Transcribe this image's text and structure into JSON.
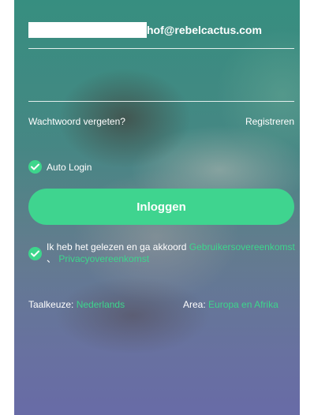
{
  "login": {
    "email_value": "hof@rebelcactus.com",
    "password_value": "",
    "forgot_label": "Wachtwoord vergeten?",
    "register_label": "Registreren",
    "auto_login_label": "Auto Login",
    "login_button": "Inloggen"
  },
  "agreement": {
    "text": "Ik heb het gelezen en ga akkoord ",
    "terms_link": "Gebruikersovereenkomst",
    "separator": " 、 ",
    "privacy_link": "Privacyovereenkomst"
  },
  "settings": {
    "language_label": "Taalkeuze:",
    "language_value": "Nederlands",
    "area_label": "Area:",
    "area_value": "Europa en Afrika"
  },
  "colors": {
    "accent": "#3fd48f"
  }
}
